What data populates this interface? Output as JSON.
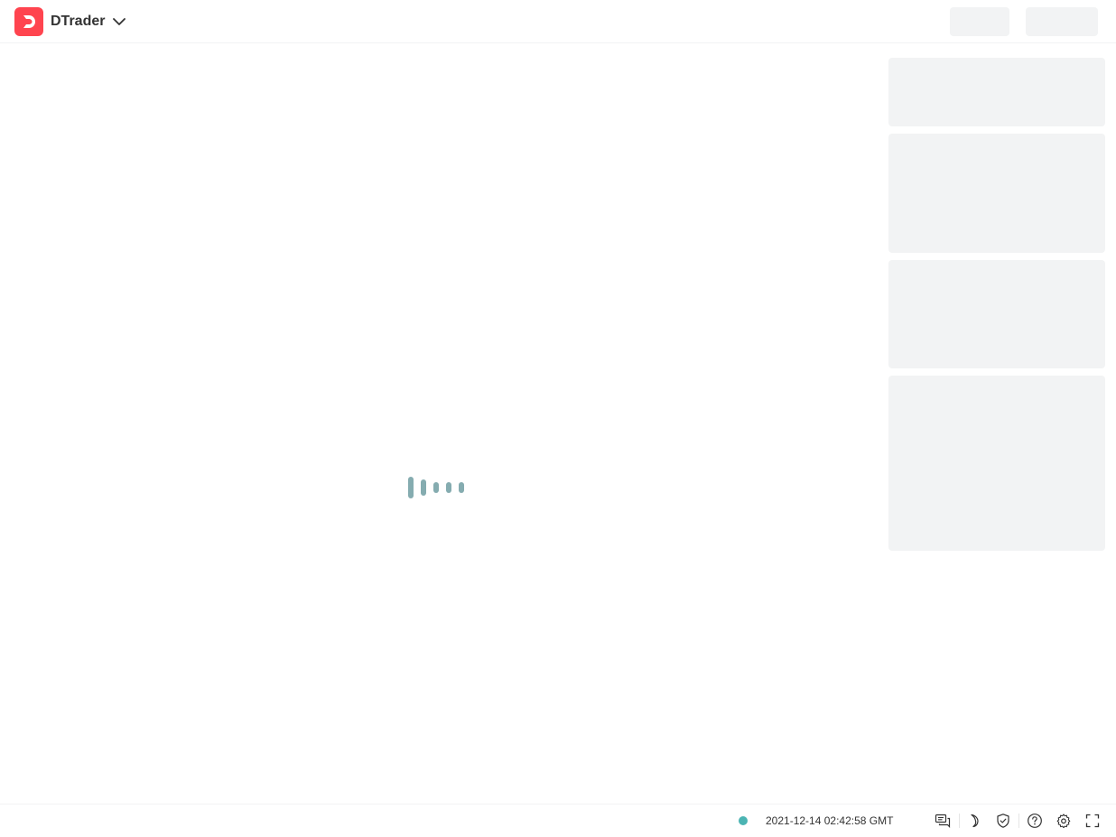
{
  "header": {
    "app_name": "DTrader",
    "logo_icon": "deriv-logo-icon",
    "dropdown_icon": "chevron-down-icon",
    "brand_color": "#ff444f"
  },
  "main": {
    "loader_icon": "loading-bars-icon",
    "loader_color": "#85acb0",
    "skeleton_color": "#f2f3f4"
  },
  "footer": {
    "connection_status_color": "#4bb4b3",
    "server_time": "2021-12-14 02:42:58 GMT",
    "icons": [
      "chat-icon",
      "dark-mode-icon",
      "responsible-trading-icon",
      "help-icon",
      "settings-icon",
      "fullscreen-icon"
    ]
  }
}
